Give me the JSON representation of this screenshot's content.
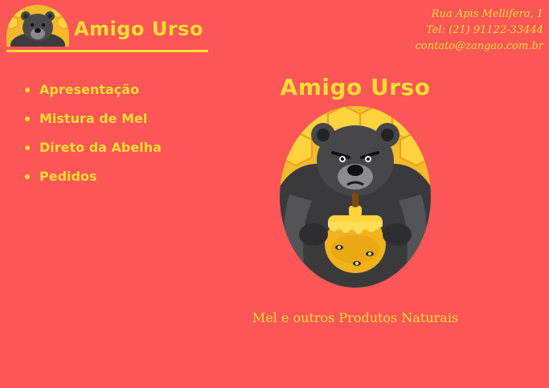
{
  "site": {
    "brand": "Amigo Urso",
    "contact": {
      "address": "Rua Apis Mellifera, 1",
      "phone": "Tel: (21) 91122-33444",
      "email": "contato@zangao.com.br"
    }
  },
  "nav": {
    "items": [
      {
        "label": "Apresentação"
      },
      {
        "label": "Mistura de Mel"
      },
      {
        "label": "Direto da Abelha"
      },
      {
        "label": "Pedidos"
      }
    ]
  },
  "hero": {
    "title": "Amigo Urso",
    "tagline": "Mel e outros Produtos Naturais"
  },
  "colors": {
    "background": "#fd5656",
    "accent": "#ffdd33"
  }
}
